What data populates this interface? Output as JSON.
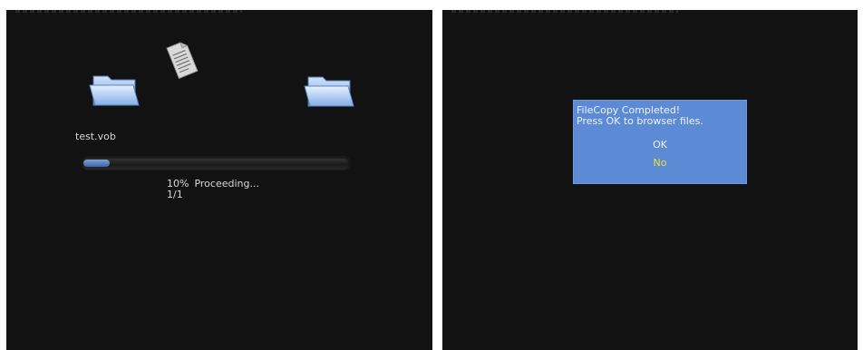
{
  "copy_screen": {
    "filename": "test.vob",
    "progress_percent": 10,
    "progress_label": "10%",
    "status_text": "Proceeding...",
    "file_count": "1/1",
    "icons": {
      "source": "folder-icon",
      "file": "document-icon",
      "destination": "folder-icon"
    }
  },
  "completion_dialog": {
    "line1": "FileCopy Completed!",
    "line2": "Press OK to browser files.",
    "option_ok": "OK",
    "option_no": "No",
    "selected_option": "No"
  },
  "colors": {
    "screen_bg": "#121212",
    "dialog_bg": "#5c8ad4",
    "progress_fill": "#4f74b8",
    "selected_text": "#e8e238"
  }
}
